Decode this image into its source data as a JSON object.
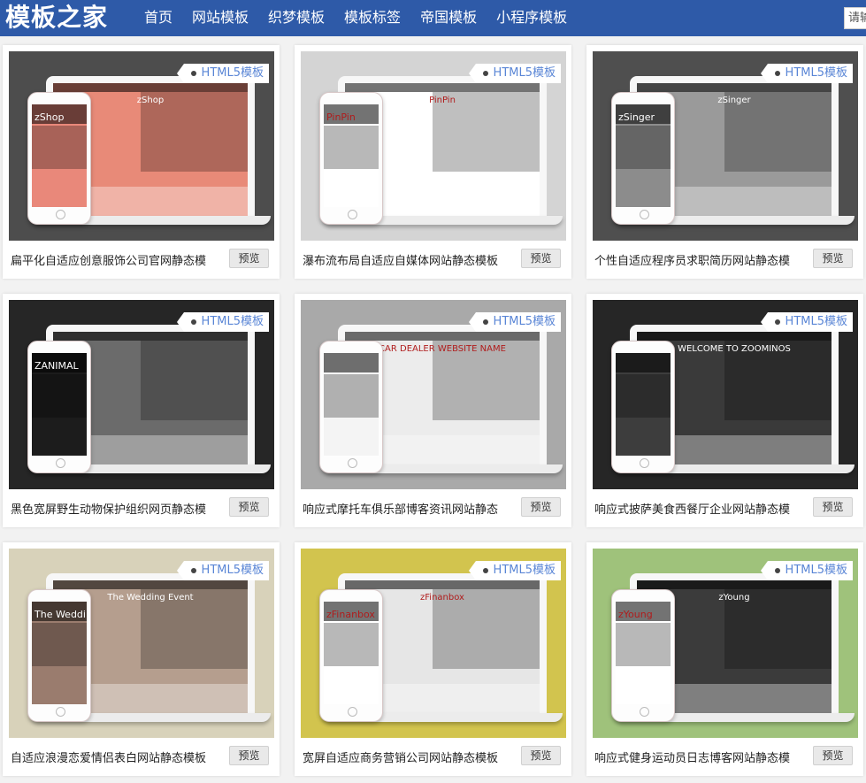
{
  "header": {
    "logo": "模板之家",
    "nav": [
      "首页",
      "网站模板",
      "织梦模板",
      "模板标签",
      "帝国模板",
      "小程序模板"
    ],
    "search_placeholder": "请输"
  },
  "tag_label": "HTML5模板",
  "preview_label": "预览",
  "cards": [
    {
      "title": "扁平化自适应创意服饰公司官网静态模",
      "thumb_bg": "#4d4d4d",
      "screen_bg": "#e88a78",
      "phone_bg": "#e9887a",
      "laptop_text": "zShop",
      "phone_text": "zShop"
    },
    {
      "title": "瀑布流布局自适应自媒体网站静态模板",
      "thumb_bg": "#d4d4d4",
      "screen_bg": "#ffffff",
      "phone_bg": "#ffffff",
      "laptop_text": "PinPin",
      "phone_text": "PinPin"
    },
    {
      "title": "个性自适应程序员求职简历网站静态模",
      "thumb_bg": "#4f4f4f",
      "screen_bg": "#9a9a9a",
      "phone_bg": "#8c8c8c",
      "laptop_text": "zSinger",
      "phone_text": "zSinger"
    },
    {
      "title": "黑色宽屏野生动物保护组织网页静态模",
      "thumb_bg": "#262626",
      "screen_bg": "#6b6b6b",
      "phone_bg": "#1c1c1c",
      "laptop_text": "",
      "phone_text": "ZANIMAL"
    },
    {
      "title": "响应式摩托车俱乐部博客资讯网站静态",
      "thumb_bg": "#a9a9a9",
      "screen_bg": "#ececec",
      "phone_bg": "#f4f4f4",
      "laptop_text": "CAR DEALER WEBSITE NAME",
      "phone_text": ""
    },
    {
      "title": "响应式披萨美食西餐厅企业网站静态模",
      "thumb_bg": "#262626",
      "screen_bg": "#3a3a3a",
      "phone_bg": "#3d3d3d",
      "laptop_text": "WELCOME TO ZOOMINOS",
      "phone_text": ""
    },
    {
      "title": "自适应浪漫恋爱情侣表白网站静态模板",
      "thumb_bg": "#d8d2ba",
      "screen_bg": "#b59e8e",
      "phone_bg": "#9a7c6e",
      "laptop_text": "The Wedding Event",
      "phone_text": "The Wedding Event"
    },
    {
      "title": "宽屏自适应商务营销公司网站静态模板",
      "thumb_bg": "#d2c44e",
      "screen_bg": "#e6e6e6",
      "phone_bg": "#ffffff",
      "laptop_text": "zFinanbox",
      "phone_text": "zFinanbox"
    },
    {
      "title": "响应式健身运动员日志博客网站静态模",
      "thumb_bg": "#9fc27b",
      "screen_bg": "#3b3b3b",
      "phone_bg": "#ffffff",
      "laptop_text": "zYoung",
      "phone_text": "zYoung"
    }
  ]
}
